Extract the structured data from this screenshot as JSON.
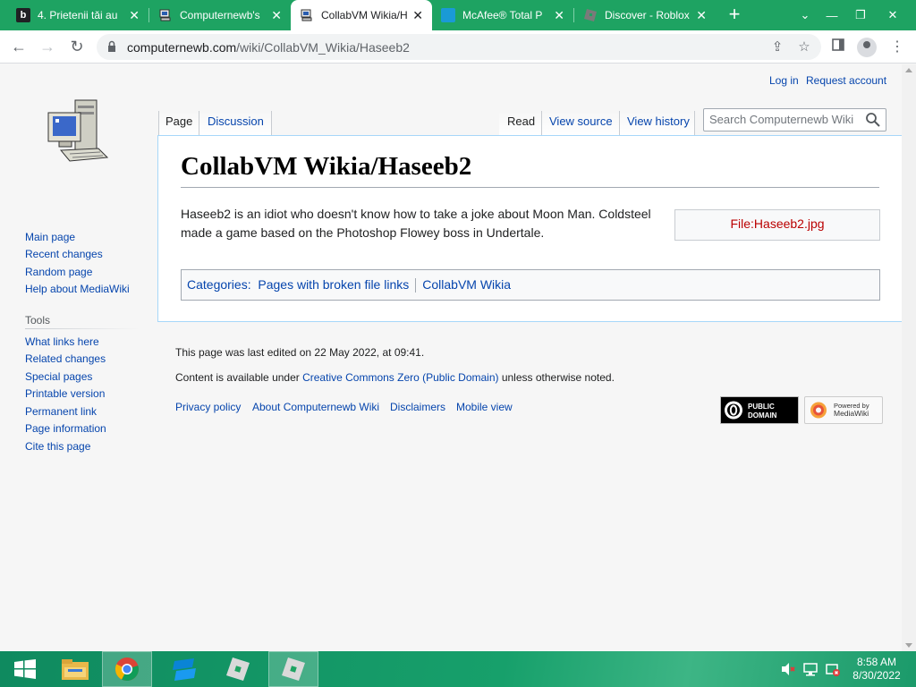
{
  "browser": {
    "tabs": [
      {
        "title": "4. Prietenii tăi au",
        "favicon": "dark-square-b-icon"
      },
      {
        "title": "Computernewb's",
        "favicon": "computer-icon"
      },
      {
        "title": "CollabVM Wikia/H",
        "favicon": "computer-icon",
        "active": true
      },
      {
        "title": "McAfee® Total P",
        "favicon": "mcafee-icon"
      },
      {
        "title": "Discover - Roblox",
        "favicon": "roblox-icon"
      }
    ],
    "url_host": "computernewb.com",
    "url_path": "/wiki/CollabVM_Wikia/Haseeb2"
  },
  "wiki": {
    "personal": {
      "login": "Log in",
      "request": "Request account"
    },
    "tabs": {
      "page": "Page",
      "discussion": "Discussion",
      "read": "Read",
      "view_source": "View source",
      "view_history": "View history"
    },
    "search_placeholder": "Search Computernewb Wiki",
    "heading": "CollabVM Wikia/Haseeb2",
    "body": "Haseeb2 is an idiot who doesn't know how to take a joke about Moon Man. Coldsteel made a game based on the Photoshop Flowey boss in Undertale.",
    "file_link": "File:Haseeb2.jpg",
    "categories_label": "Categories",
    "categories": [
      "Pages with broken file links",
      "CollabVM Wikia"
    ],
    "nav": [
      "Main page",
      "Recent changes",
      "Random page",
      "Help about MediaWiki"
    ],
    "tools_heading": "Tools",
    "tools": [
      "What links here",
      "Related changes",
      "Special pages",
      "Printable version",
      "Permanent link",
      "Page information",
      "Cite this page"
    ],
    "footer": {
      "last_edited": "This page was last edited on 22 May 2022, at 09:41.",
      "content_prefix": "Content is available under ",
      "license": "Creative Commons Zero (Public Domain)",
      "content_suffix": " unless otherwise noted.",
      "links": [
        "Privacy policy",
        "About Computernewb Wiki",
        "Disclaimers",
        "Mobile view"
      ],
      "badge_pd": "PUBLIC DOMAIN",
      "badge_mw_top": "Powered by",
      "badge_mw_bottom": "MediaWiki"
    }
  },
  "taskbar": {
    "time": "8:58 AM",
    "date": "8/30/2022"
  },
  "colors": {
    "tabstrip": "#1ea362",
    "link": "#0645ad",
    "redlink": "#ba0000"
  }
}
